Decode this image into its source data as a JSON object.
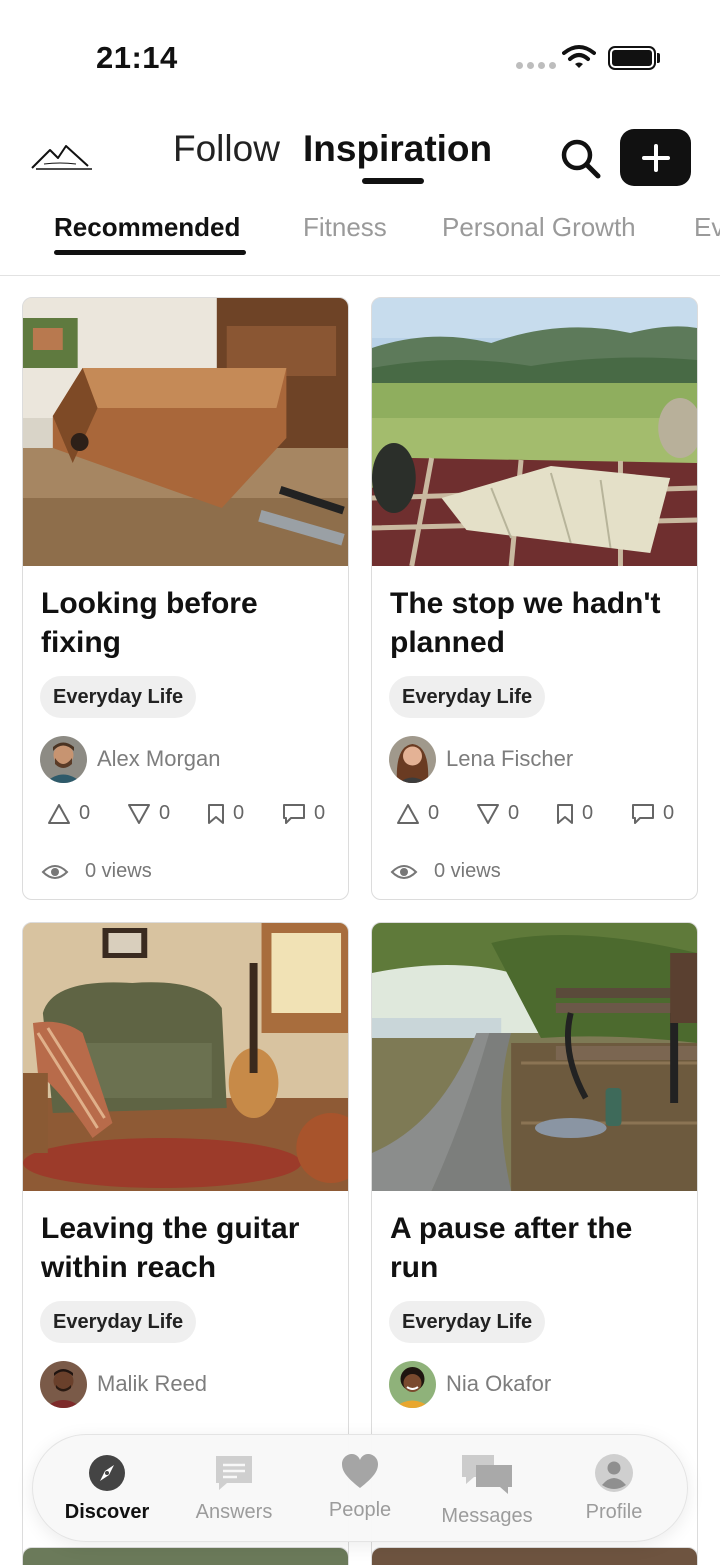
{
  "status_bar": {
    "time": "21:14"
  },
  "header": {
    "tabs": [
      {
        "label": "Follow"
      },
      {
        "label": "Inspiration"
      }
    ]
  },
  "categories": [
    "Recommended",
    "Fitness",
    "Personal Growth",
    "Ev"
  ],
  "cards": [
    {
      "title": "Looking before fixing",
      "tag": "Everyday Life",
      "author": "Alex Morgan",
      "upvotes": "0",
      "downvotes": "0",
      "saves": "0",
      "comments": "0",
      "views": "0 views"
    },
    {
      "title": "The stop we hadn't planned",
      "tag": "Everyday Life",
      "author": "Lena Fischer",
      "upvotes": "0",
      "downvotes": "0",
      "saves": "0",
      "comments": "0",
      "views": "0 views"
    },
    {
      "title": "Leaving the guitar within reach",
      "tag": "Everyday Life",
      "author": "Malik Reed"
    },
    {
      "title": "A pause after the run",
      "tag": "Everyday Life",
      "author": "Nia Okafor"
    }
  ],
  "bottom_nav": [
    {
      "label": "Discover",
      "icon": "compass-icon",
      "active": true
    },
    {
      "label": "Answers",
      "icon": "chat-lines-icon"
    },
    {
      "label": "People",
      "icon": "heart-icon"
    },
    {
      "label": "Messages",
      "icon": "messages-icon"
    },
    {
      "label": "Profile",
      "icon": "person-icon"
    }
  ],
  "colors": {
    "primary": "#111111",
    "muted": "#9a9a9a",
    "tag_bg": "#efefef"
  }
}
